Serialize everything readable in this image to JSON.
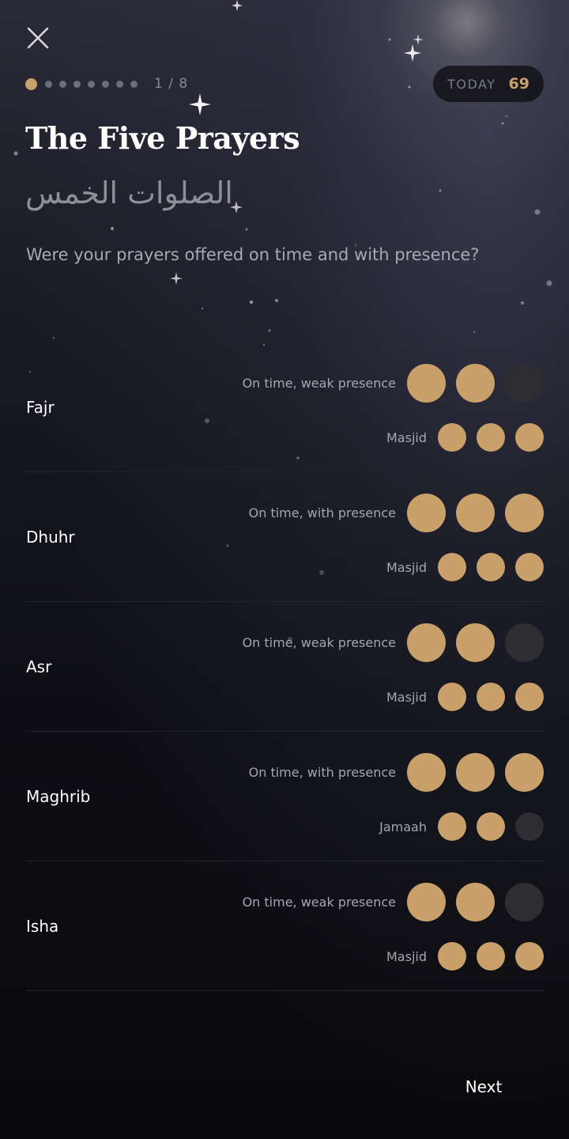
{
  "header": {
    "close_icon": "close-icon",
    "step_label": "1 / 8",
    "total_steps": 8,
    "current_step": 1,
    "today_label": "TODAY",
    "today_count": "69"
  },
  "page": {
    "title": "The Five Prayers",
    "arabic_title": "الصلوات الخمس",
    "subtitle": "Were your prayers offered on time and with presence?"
  },
  "prayers": [
    {
      "name": "Fajr",
      "quality_label": "On time, weak presence",
      "quality_rating": 2,
      "quality_max": 3,
      "venue_label": "Masjid",
      "venue_rating": 3,
      "venue_max": 3
    },
    {
      "name": "Dhuhr",
      "quality_label": "On time, with presence",
      "quality_rating": 3,
      "quality_max": 3,
      "venue_label": "Masjid",
      "venue_rating": 3,
      "venue_max": 3
    },
    {
      "name": "Asr",
      "quality_label": "On time, weak presence",
      "quality_rating": 2,
      "quality_max": 3,
      "venue_label": "Masjid",
      "venue_rating": 3,
      "venue_max": 3
    },
    {
      "name": "Maghrib",
      "quality_label": "On time, with presence",
      "quality_rating": 3,
      "quality_max": 3,
      "venue_label": "Jamaah",
      "venue_rating": 2,
      "venue_max": 3
    },
    {
      "name": "Isha",
      "quality_label": "On time, weak presence",
      "quality_rating": 2,
      "quality_max": 3,
      "venue_label": "Masjid",
      "venue_rating": 3,
      "venue_max": 3
    }
  ],
  "footer": {
    "next_label": "Next"
  },
  "colors": {
    "accent_gold": "#c9a06a",
    "inactive_circle": "#2d2d32",
    "background_top": "#2a2a38",
    "background_bottom": "#0a0a0d"
  }
}
